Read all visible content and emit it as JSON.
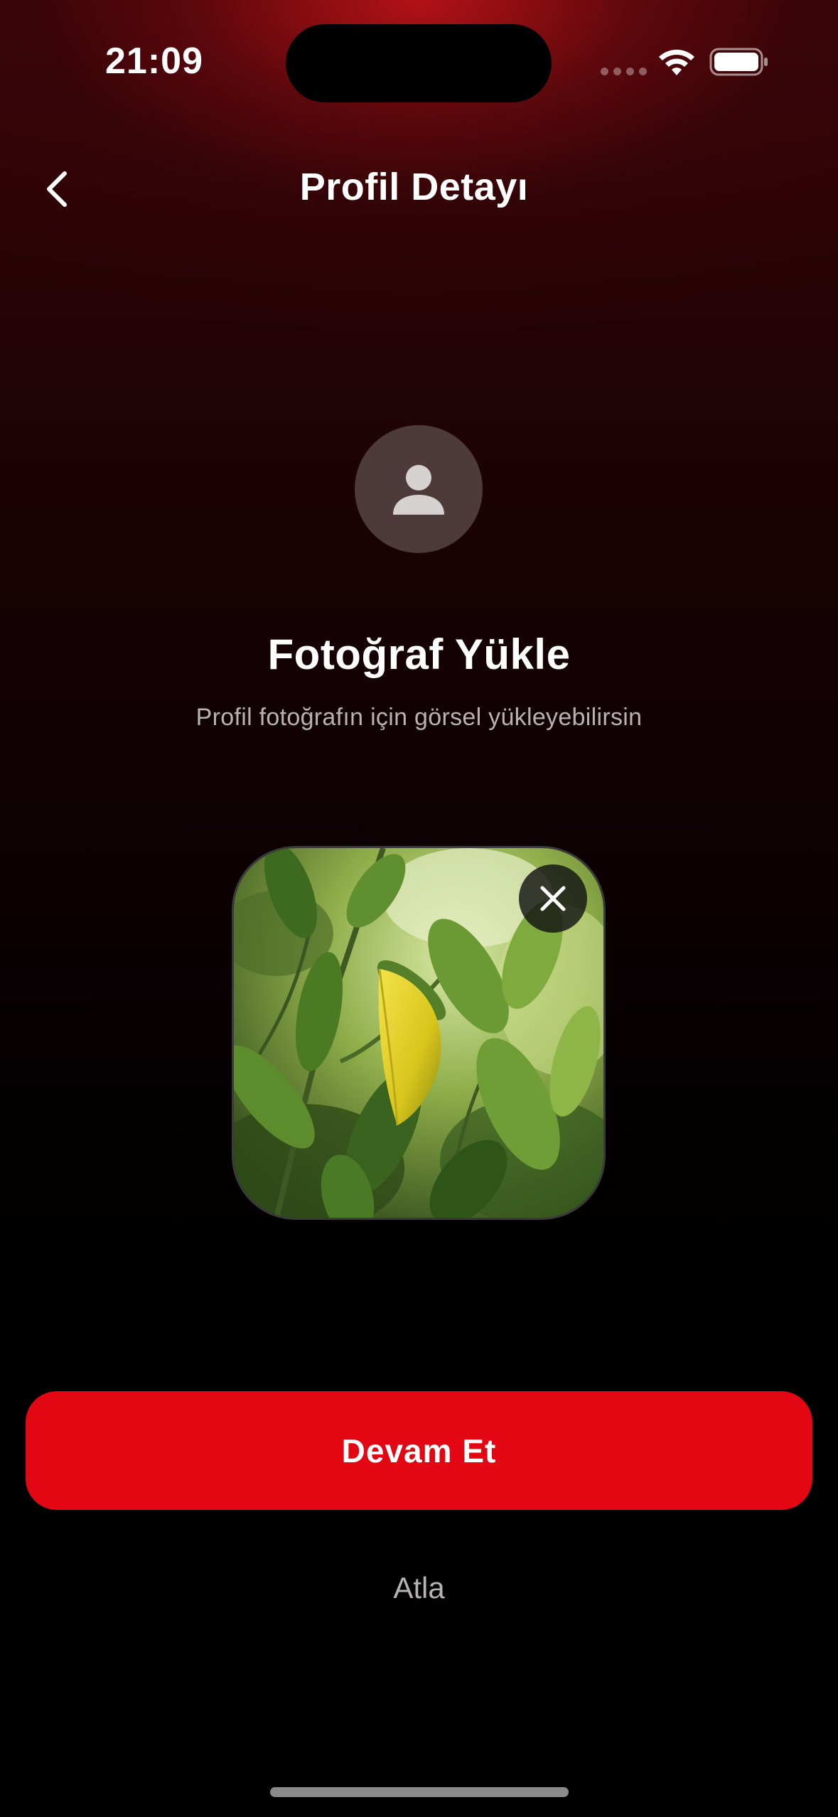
{
  "status_bar": {
    "time": "21:09",
    "icons": [
      "cellular-signal-icon",
      "wifi-icon",
      "battery-icon"
    ]
  },
  "header": {
    "back_icon": "chevron-left-icon",
    "title": "Profil Detayı"
  },
  "avatar": {
    "icon": "person-icon"
  },
  "upload": {
    "title": "Fotoğraf Yükle",
    "subtitle": "Profil fotoğrafın için görsel yükleyebilirsin"
  },
  "photo": {
    "remove_icon": "close-icon"
  },
  "actions": {
    "continue_label": "Devam Et",
    "skip_label": "Atla"
  },
  "colors": {
    "accent": "#e30613",
    "background": "#000000",
    "gradient_top": "#c8141a"
  }
}
